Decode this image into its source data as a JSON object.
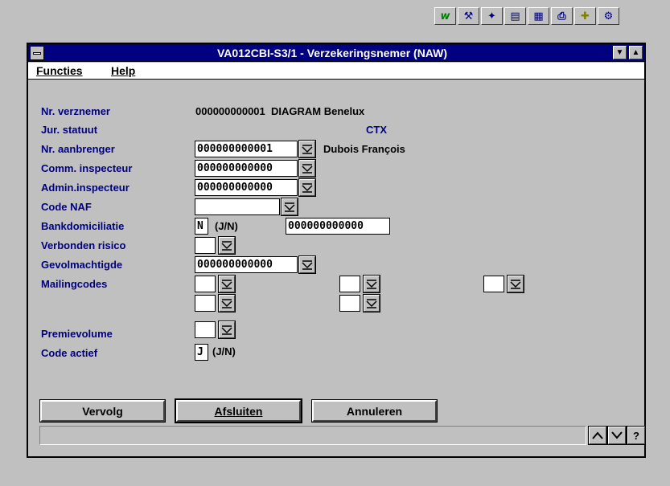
{
  "toolbar": {
    "icons": [
      "wand-icon",
      "tools-icon",
      "scan-icon",
      "clipboard-icon",
      "calculator-icon",
      "printer-icon",
      "puzzle-icon",
      "settings-icon"
    ]
  },
  "window": {
    "title": "VA012CBI-S3/1 - Verzekeringsnemer (NAW)"
  },
  "menubar": {
    "functies": "Functies",
    "help": "Help"
  },
  "form": {
    "nr_verznemer": {
      "label": "Nr. verznemer",
      "value": "000000000001  DIAGRAM Benelux"
    },
    "jur_statuut": {
      "label": "Jur. statuut",
      "value": "CTX"
    },
    "nr_aanbrenger": {
      "label": "Nr. aanbrenger",
      "value": "000000000001",
      "name": "Dubois François"
    },
    "comm_inspecteur": {
      "label": "Comm. inspecteur",
      "value": "000000000000"
    },
    "admin_inspecteur": {
      "label": "Admin.inspecteur",
      "value": "000000000000"
    },
    "code_naf": {
      "label": "Code NAF",
      "value": ""
    },
    "bankdomiciliatie": {
      "label": "Bankdomiciliatie",
      "value": "N",
      "hint": "(J/N)",
      "account": "000000000000"
    },
    "verbonden_risico": {
      "label": "Verbonden risico",
      "value": ""
    },
    "gevolmachtigde": {
      "label": "Gevolmachtigde",
      "value": "000000000000"
    },
    "mailingcodes": {
      "label": "Mailingcodes"
    },
    "premievolume": {
      "label": "Premievolume",
      "value": ""
    },
    "code_actief": {
      "label": "Code actief",
      "value": "J",
      "hint": "(J/N)"
    }
  },
  "buttons": {
    "vervolg": "Vervolg",
    "afsluiten": "Afsluiten",
    "annuleren": "Annuleren"
  },
  "statusbar": {
    "text": "",
    "help": "?"
  }
}
